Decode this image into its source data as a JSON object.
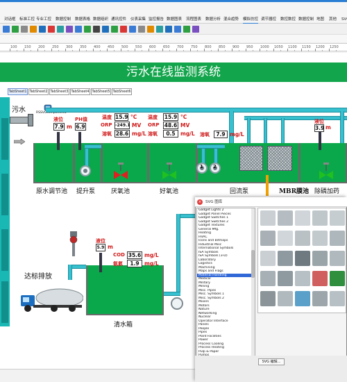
{
  "menu_tabs": [
    {
      "label": "对话框"
    },
    {
      "label": "标准工控"
    },
    {
      "label": "专业工控"
    },
    {
      "label": "数据控制"
    },
    {
      "label": "数据表格"
    },
    {
      "label": "数据组织"
    },
    {
      "label": "通讯控件"
    },
    {
      "label": "仪表采集"
    },
    {
      "label": "监控报告"
    },
    {
      "label": "数据图表"
    },
    {
      "label": "流程图表"
    },
    {
      "label": "数据分析"
    },
    {
      "label": "混合趋势"
    },
    {
      "label": "模拟仿控"
    },
    {
      "label": "调节器控"
    },
    {
      "label": "数控数控"
    },
    {
      "label": "数据控制"
    },
    {
      "label": "地图"
    },
    {
      "label": "其他"
    },
    {
      "label": "SVG"
    }
  ],
  "ruler_labels": [
    "100",
    "150",
    "200",
    "250",
    "300",
    "350",
    "400",
    "450",
    "500",
    "550",
    "600",
    "650",
    "700",
    "750",
    "800",
    "850",
    "900",
    "950",
    "1000",
    "1050",
    "1100",
    "1150",
    "1200",
    "1250"
  ],
  "page_title": "污水在线监测系统",
  "sheet_tabs": [
    "TabSheet1",
    "TabSheet2",
    "TabSheet3",
    "TabSheet4",
    "TabSheet5",
    "TabSheet6"
  ],
  "inlet": {
    "label": "污水",
    "component_tag": "RSSVGcomponent1"
  },
  "level1": {
    "label": "液位",
    "value": "7.9",
    "unit": "m"
  },
  "ph": {
    "label": "PH值",
    "value": "6.9"
  },
  "anoxic": {
    "temp_label": "温度",
    "temp_value": "15.9",
    "temp_unit": "°C",
    "orp_label": "ORP",
    "orp_value": "-249.1",
    "orp_unit": "MV",
    "do_label": "溶氧",
    "do_value": "28.6",
    "do_unit": "mg/L"
  },
  "aerobic": {
    "temp_label": "温度",
    "temp_value": "15.9",
    "temp_unit": "°C",
    "orp_label": "ORP",
    "orp_value": "48.6",
    "orp_unit": "MV",
    "do_label": "溶氧",
    "do_value": "0.5",
    "do_unit": "mg/L"
  },
  "reflux": {
    "do_label": "溶氧",
    "do_value": "7.9",
    "do_unit": "mg/L"
  },
  "dephos": {
    "label": "液位",
    "value": "3.9",
    "unit": "m"
  },
  "pump_numbers": [
    "1",
    "2"
  ],
  "process_labels": [
    "原水调节池",
    "提升泵",
    "厌氧池",
    "好氧池",
    "回流泵",
    "MBR膜池",
    "除磷加药"
  ],
  "clear_tank": {
    "level_label": "液位",
    "level_value": "5.9",
    "level_unit": "m",
    "cod_label": "COD",
    "cod_value": "35.6",
    "cod_unit": "mg/L",
    "nh_label": "氨氮",
    "nh_value": "1.9",
    "nh_unit": "mg/L",
    "name": "清水箱"
  },
  "discharge_label": "达标排放",
  "colors": {
    "title_green": "#12a54b",
    "tank_green": "#0aa84a",
    "pipe_cyan": "#37c0cf",
    "value_red": "#d01818",
    "valve_red": "#e02020",
    "valve_green": "#20c020"
  },
  "svg_dialog": {
    "title": "SVG 图库",
    "edit_button": "SVG 编辑...",
    "selected": "Material Handling",
    "items": [
      "Gadget Lights 2",
      "Gadget Panel Pieces",
      "Gadget Switches 1",
      "Gadget Switches 2",
      "Gadget Textures",
      "General Mfg.",
      "Heating",
      "HVAC",
      "Icons and Bitmaps",
      "Industrial Misc",
      "International Symbols",
      "ISA Symbols",
      "ISA Symbols (3-D)",
      "Laboratory",
      "Logistics",
      "Machining",
      "Maps and Flags",
      "Material Handling",
      "Medical",
      "Military",
      "Mining",
      "Misc. Pipes",
      "Misc. Symbols 1",
      "Misc. Symbols 2",
      "Mixers",
      "Motors",
      "Nature",
      "Networking",
      "Nuclear",
      "Operator Interface",
      "Panels",
      "People",
      "Pipes",
      "Plant Facilities",
      "Power",
      "Process Cooling",
      "Process Heating",
      "Pulp & Paper",
      "Pumps"
    ],
    "grid_icon_names": [
      "pipe-elbow-icon",
      "pipe-elbow-icon",
      "pipe-tee-icon",
      "pipe-elbow-icon",
      "pipe-fitting-icon",
      "pipe-valve-icon",
      "pipe-elbow-icon",
      "pipe-bend-icon",
      "pipe-fitting-icon",
      "pipe-reducer-icon",
      "pipe-flange-icon",
      "tank-icon",
      "conveyor-icon",
      "machine-icon",
      "drum-icon",
      "hopper-icon",
      "separator-icon",
      "cyclone-icon",
      "chute-icon",
      "funnel-icon",
      "crane-icon",
      "lift-icon",
      "truck-icon",
      "bin-icon",
      "tank-icon"
    ]
  }
}
